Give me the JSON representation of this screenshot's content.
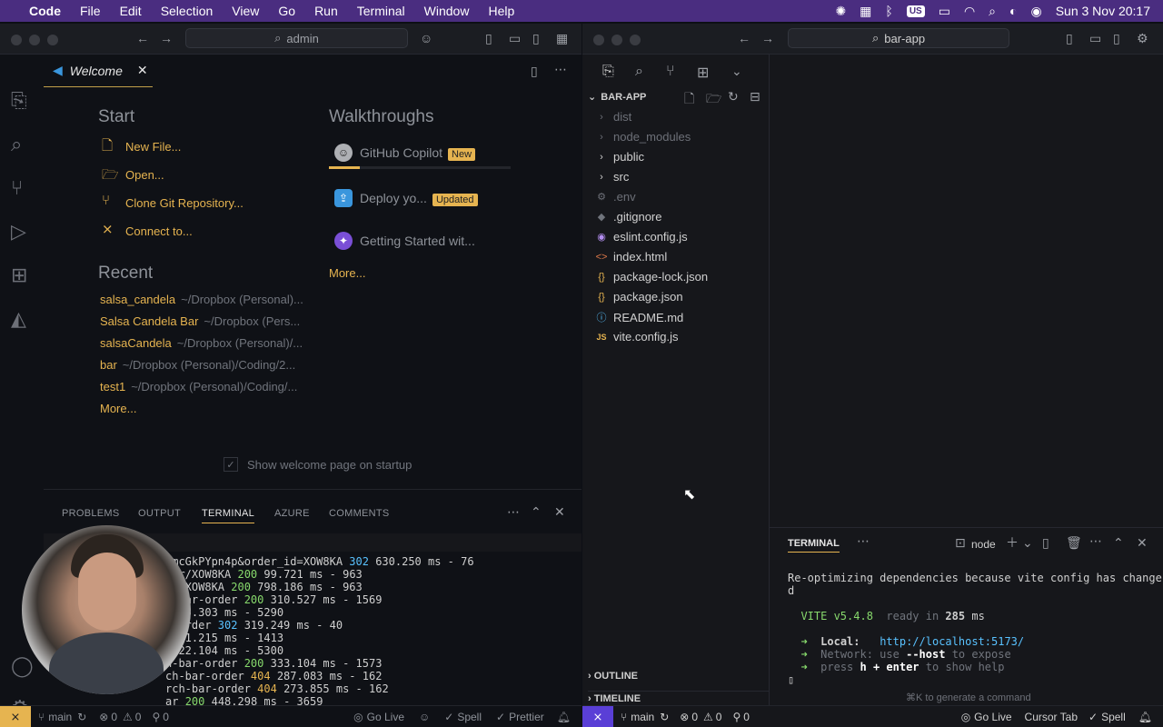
{
  "menubar": {
    "items": [
      "Code",
      "File",
      "Edit",
      "Selection",
      "View",
      "Go",
      "Run",
      "Terminal",
      "Window",
      "Help"
    ],
    "keyboard": "US",
    "datetime": "Sun 3 Nov  20:17"
  },
  "left_window": {
    "command_center": "admin",
    "tab_label": "Welcome",
    "start_heading": "Start",
    "start_items": [
      "New File...",
      "Open...",
      "Clone Git Repository...",
      "Connect to..."
    ],
    "recent_heading": "Recent",
    "recent_items": [
      {
        "name": "salsa_candela",
        "path": "~/Dropbox (Personal)..."
      },
      {
        "name": "Salsa Candela Bar",
        "path": "~/Dropbox (Pers..."
      },
      {
        "name": "salsaCandela",
        "path": "~/Dropbox (Personal)/..."
      },
      {
        "name": "bar",
        "path": "~/Dropbox (Personal)/Coding/2..."
      },
      {
        "name": "test1",
        "path": "~/Dropbox (Personal)/Coding/..."
      }
    ],
    "recent_more": "More...",
    "walkthroughs_heading": "Walkthroughs",
    "walkthroughs": [
      {
        "label": "GitHub Copilot",
        "badge": "New"
      },
      {
        "label": "Deploy yo...",
        "badge": "Updated"
      },
      {
        "label": "Getting Started wit...",
        "badge": ""
      }
    ],
    "walk_more": "More...",
    "show_welcome": "Show welcome page on startup",
    "panel_tabs": [
      "PROBLEMS",
      "OUTPUT",
      "TERMINAL",
      "AZURE",
      "COMMENTS"
    ],
    "terminal_lines": [
      {
        "a": "zmcGkPYpn4p&order_id=XOW8KA ",
        "code": "302",
        "rest": " 630.250 ms - 76"
      },
      {
        "a": "der/XOW8KA ",
        "code": "200",
        "rest": " 99.721 ms - 963"
      },
      {
        "a": "er/XOW8KA ",
        "code": "200",
        "rest": " 798.186 ms - 963"
      },
      {
        "a": "h-bar-order ",
        "code": "200",
        "rest": " 310.527 ms - 1569"
      },
      {
        "a": "",
        "code": "",
        "rest": " 395.303 ms - 5290"
      },
      {
        "a": "l-order ",
        "code": "302",
        "rest": " 319.249 ms - 40"
      },
      {
        "a": "",
        "code": "",
        "rest": " 801.215 ms - 1413"
      },
      {
        "a": "",
        "code": "",
        "rest": " 322.104 ms - 5300"
      },
      {
        "a": "h-bar-order ",
        "code": "200",
        "rest": " 333.104 ms - 1573"
      },
      {
        "a": "ch-bar-order ",
        "code": "404",
        "rest": " 287.083 ms - 162"
      },
      {
        "a": "rch-bar-order ",
        "code": "404",
        "rest": " 273.855 ms - 162"
      },
      {
        "a": "ar ",
        "code": "200",
        "rest": " 448.298 ms - 3659"
      }
    ],
    "status": {
      "branch": "main",
      "errors": "0",
      "warnings": "0",
      "ports": "0",
      "golive": "Go Live",
      "spell": "Spell",
      "prettier": "Prettier"
    }
  },
  "right_window": {
    "command_center": "bar-app",
    "explorer_root": "BAR-APP",
    "tree": [
      {
        "name": "dist",
        "icon": "chevron-right",
        "dim": true
      },
      {
        "name": "node_modules",
        "icon": "chevron-right",
        "dim": true
      },
      {
        "name": "public",
        "icon": "chevron-right",
        "dim": false
      },
      {
        "name": "src",
        "icon": "chevron-right",
        "dim": false
      },
      {
        "name": ".env",
        "icon": "gear",
        "dim": true
      },
      {
        "name": ".gitignore",
        "icon": "diamond",
        "dim": false
      },
      {
        "name": "eslint.config.js",
        "icon": "circle",
        "dim": false
      },
      {
        "name": "index.html",
        "icon": "html",
        "dim": false
      },
      {
        "name": "package-lock.json",
        "icon": "braces",
        "dim": false
      },
      {
        "name": "package.json",
        "icon": "braces",
        "dim": false
      },
      {
        "name": "README.md",
        "icon": "info",
        "dim": false
      },
      {
        "name": "vite.config.js",
        "icon": "js",
        "dim": false
      }
    ],
    "outline": "OUTLINE",
    "timeline": "TIMELINE",
    "terminal_title": "TERMINAL",
    "terminal_shell": "node",
    "term_msg1": "Re-optimizing dependencies because vite config has change",
    "term_msg2": "d",
    "vite_label": "VITE v5.4.8",
    "vite_ready": "ready in",
    "vite_ms": "285",
    "vite_ms_unit": "ms",
    "local_label": "Local:",
    "local_url": "http://localhost:5173/",
    "network_label": "Network:",
    "network_text1": "use",
    "network_flag": "--host",
    "network_text2": "to expose",
    "help_text1": "press",
    "help_key": "h + enter",
    "help_text2": "to show help",
    "cmd_hint": "⌘K to generate a command",
    "status": {
      "branch": "main",
      "errors": "0",
      "warnings": "0",
      "ports": "0",
      "golive": "Go Live",
      "cursor_tab": "Cursor Tab",
      "spell": "Spell"
    }
  }
}
